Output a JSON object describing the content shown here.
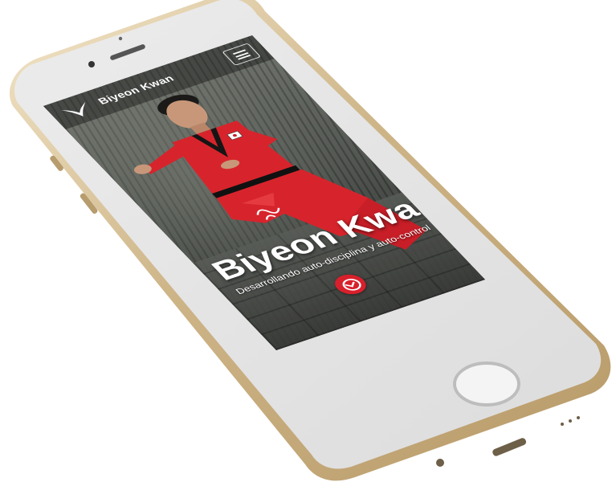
{
  "navbar": {
    "brand_name": "Biyeon Kwan",
    "logo_icon": "phoenix-wing-icon",
    "menu_icon": "hamburger-menu-icon"
  },
  "hero": {
    "title": "Biyeon Kwan",
    "subtitle": "Desarrollando auto-disciplina y auto-control",
    "scroll_icon": "chevron-down-circle-icon"
  },
  "colors": {
    "accent": "#d8202c",
    "uniform": "#d7242c",
    "device_frame": "#d9c6a3",
    "device_face": "#e4e4e4"
  }
}
